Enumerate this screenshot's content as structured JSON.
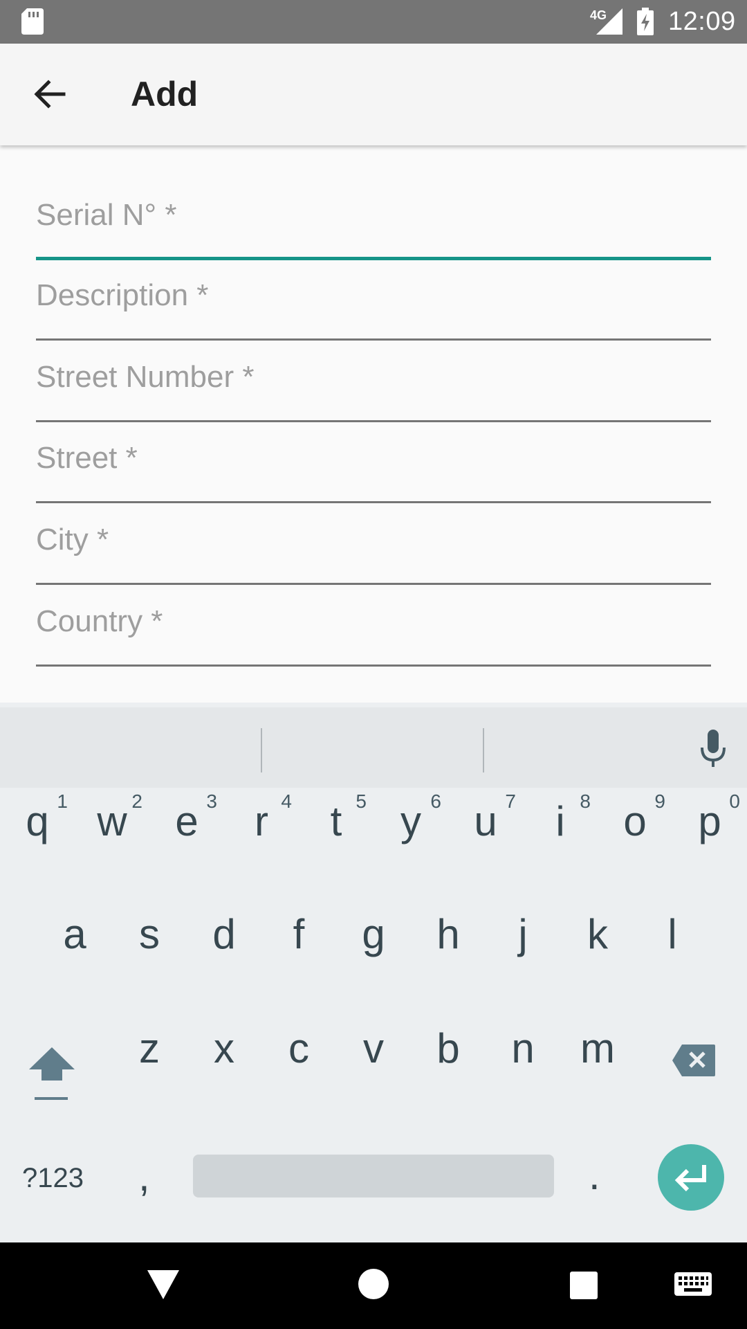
{
  "status_bar": {
    "network_label": "4G",
    "time": "12:09",
    "icons": [
      "sd-card-icon",
      "signal-icon",
      "battery-charging-icon"
    ]
  },
  "app_bar": {
    "title": "Add",
    "back_icon": "arrow-back-icon"
  },
  "form": {
    "active_field": "serial",
    "fields": [
      {
        "key": "serial",
        "placeholder": "Serial N° *",
        "value": ""
      },
      {
        "key": "description",
        "placeholder": "Description *",
        "value": ""
      },
      {
        "key": "street_number",
        "placeholder": "Street Number *",
        "value": ""
      },
      {
        "key": "street",
        "placeholder": "Street *",
        "value": ""
      },
      {
        "key": "city",
        "placeholder": "City *",
        "value": ""
      },
      {
        "key": "country",
        "placeholder": "Country *",
        "value": ""
      }
    ],
    "accent_color": "#169488"
  },
  "keyboard": {
    "row1": [
      {
        "key": "q",
        "hint": "1"
      },
      {
        "key": "w",
        "hint": "2"
      },
      {
        "key": "e",
        "hint": "3"
      },
      {
        "key": "r",
        "hint": "4"
      },
      {
        "key": "t",
        "hint": "5"
      },
      {
        "key": "y",
        "hint": "6"
      },
      {
        "key": "u",
        "hint": "7"
      },
      {
        "key": "i",
        "hint": "8"
      },
      {
        "key": "o",
        "hint": "9"
      },
      {
        "key": "p",
        "hint": "0"
      }
    ],
    "row2": [
      "a",
      "s",
      "d",
      "f",
      "g",
      "h",
      "j",
      "k",
      "l"
    ],
    "row3": [
      "z",
      "x",
      "c",
      "v",
      "b",
      "n",
      "m"
    ],
    "symbols_label": "?123",
    "comma": ",",
    "period": ".",
    "enter_color": "#4db6ac"
  },
  "nav_bar": {
    "icons": [
      "nav-back-icon",
      "nav-home-icon",
      "nav-recents-icon",
      "keyboard-icon"
    ]
  }
}
